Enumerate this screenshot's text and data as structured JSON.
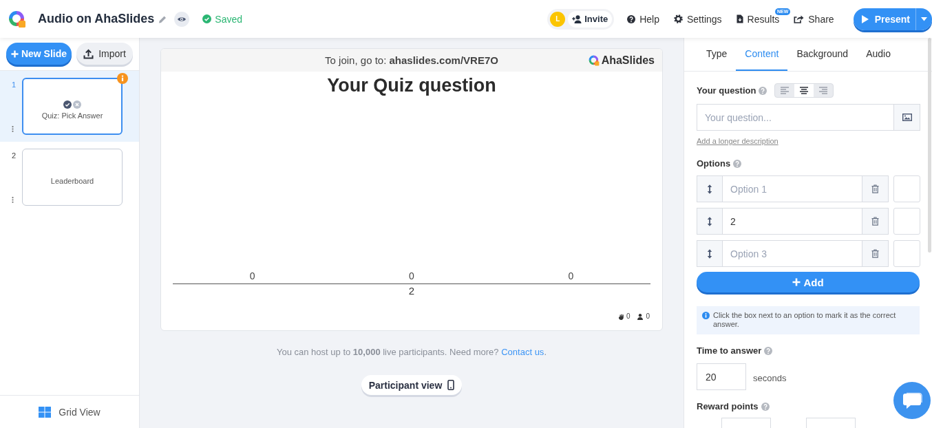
{
  "header": {
    "title": "Audio on AhaSlides",
    "status": "Saved",
    "avatar": "L",
    "invite": "Invite",
    "nav": [
      {
        "kind": "help",
        "label": "Help"
      },
      {
        "kind": "settings",
        "label": "Settings"
      },
      {
        "kind": "results",
        "label": "Results",
        "badge": "NEW"
      },
      {
        "kind": "share",
        "label": "Share"
      }
    ],
    "present": "Present"
  },
  "sidebar": {
    "new_slide": "New Slide",
    "import": "Import",
    "slides": [
      {
        "number": "1",
        "kind": "quiz",
        "label": "Quiz: Pick Answer",
        "selected": true,
        "warning": true
      },
      {
        "number": "2",
        "kind": "leaderboard",
        "label": "Leaderboard",
        "selected": false,
        "warning": false
      }
    ],
    "grid_view": "Grid View"
  },
  "slide_preview": {
    "join": "To join, go to: **ahaslides.com/VRE7O**",
    "brand": "AhaSlides",
    "title": "Your Quiz question",
    "results": [
      {
        "count": "0"
      },
      {
        "count": "0",
        "label": "2"
      },
      {
        "count": "0"
      }
    ],
    "reactions": "0",
    "participants": "0"
  },
  "host_note": {
    "text": "You can host up to **10,000** live participants. Need more?",
    "link": "Contact us",
    "after": "."
  },
  "participant_view": "Participant view",
  "editor": {
    "tabs": [
      {
        "label": "Type",
        "selected": false
      },
      {
        "label": "Content",
        "selected": true
      },
      {
        "label": "Background",
        "selected": false
      },
      {
        "label": "Audio",
        "selected": false
      }
    ],
    "question": {
      "label": "Your question",
      "alignment": [
        {
          "kind": "left",
          "selected": false
        },
        {
          "kind": "center",
          "selected": true
        },
        {
          "kind": "right",
          "selected": false
        }
      ],
      "placeholder": "Your question...",
      "description_link": "Add a longer description"
    },
    "options": {
      "label": "Options",
      "items": [
        {
          "placeholder": "Option 1",
          "checked": false
        },
        {
          "value": "2",
          "checked": false
        },
        {
          "placeholder": "Option 3",
          "checked": false
        }
      ],
      "add": "Add"
    },
    "hint": "Click the box next to an option to mark it as the correct answer.",
    "time": {
      "label": "Time to answer",
      "value": "20",
      "unit": "seconds"
    },
    "reward": {
      "label": "Reward points"
    }
  }
}
